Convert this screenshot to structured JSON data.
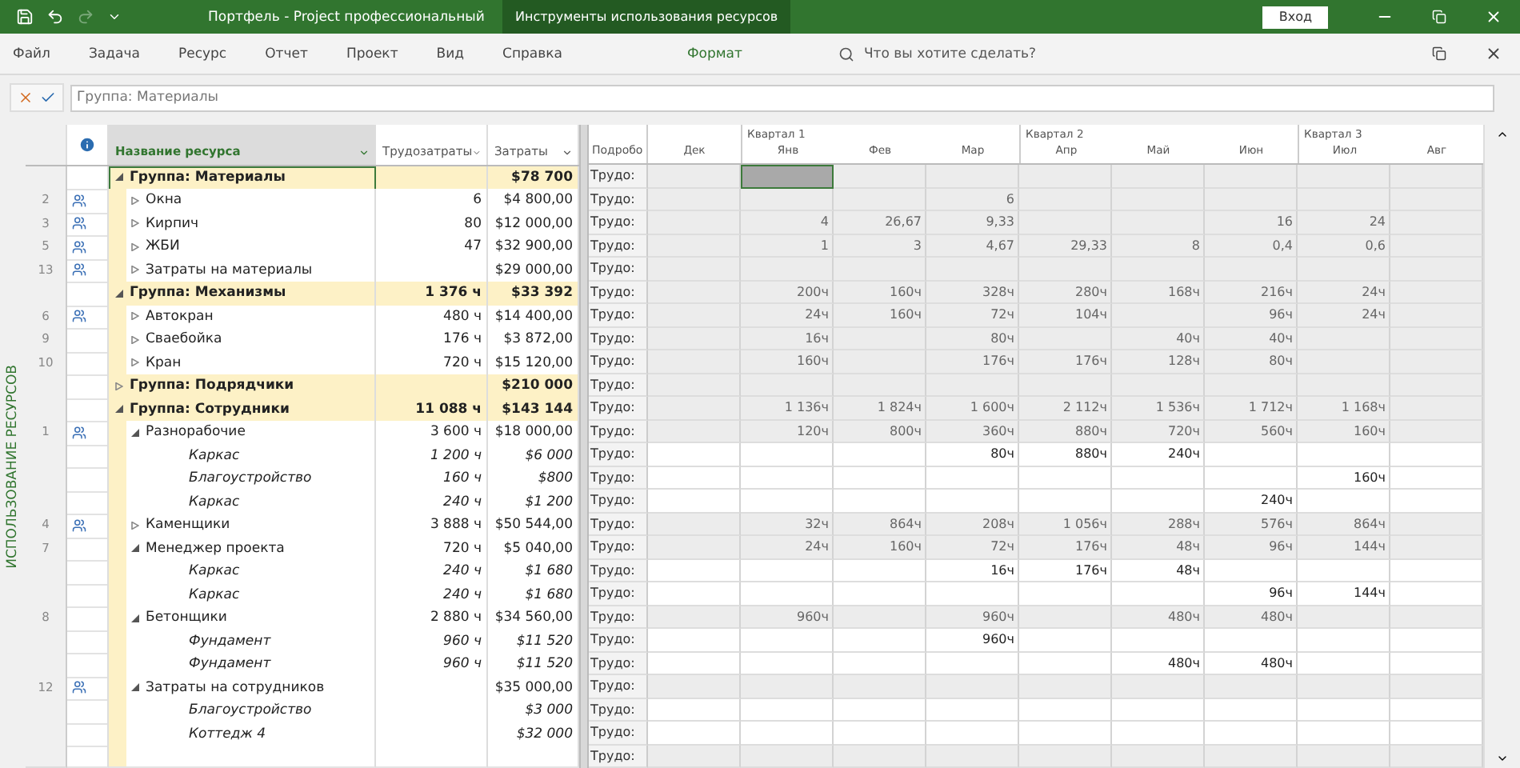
{
  "title_bar": {
    "title": "Портфель  -  Project профессиональный",
    "context_tab": "Инструменты использования ресурсов",
    "sign_in": "Вход"
  },
  "ribbon": {
    "tabs": [
      {
        "label": "Файл",
        "kind": "normal"
      },
      {
        "label": "Задача",
        "kind": "normal"
      },
      {
        "label": "Ресурс",
        "kind": "normal"
      },
      {
        "label": "Отчет",
        "kind": "normal"
      },
      {
        "label": "Проект",
        "kind": "normal"
      },
      {
        "label": "Вид",
        "kind": "normal"
      },
      {
        "label": "Справка",
        "kind": "normal"
      },
      {
        "label": "Формат",
        "kind": "context"
      }
    ],
    "search": {
      "placeholder": "Что вы хотите сделать?"
    }
  },
  "entry_bar": {
    "value": "Группа: Материалы"
  },
  "side_label": "ИСПОЛЬЗОВАНИЕ РЕСУРСОВ",
  "table": {
    "columns": [
      {
        "label": "Название ресурса",
        "selected": true
      },
      {
        "label": "Трудозатраты",
        "selected": false
      },
      {
        "label": "Затраты",
        "selected": false
      }
    ],
    "detail_header": "Подробо"
  },
  "timescale": {
    "months": [
      {
        "label": "Дек",
        "selected": false
      },
      {
        "label": "Янв",
        "quarter": "Квартал 1",
        "selected": true
      },
      {
        "label": "Фев",
        "selected": false
      },
      {
        "label": "Мар",
        "selected": false
      },
      {
        "label": "Апр",
        "quarter": "Квартал 2",
        "selected": false
      },
      {
        "label": "Май",
        "selected": false
      },
      {
        "label": "Июн",
        "selected": false
      },
      {
        "label": "Июл",
        "quarter": "Квартал 3",
        "selected": false
      },
      {
        "label": "Авг",
        "selected": false
      }
    ]
  },
  "rows": [
    {
      "kind": "group",
      "name": "Группа: Материалы",
      "expanded": true,
      "selected": true,
      "cost": "$78 700",
      "detail": "Трудо:",
      "children": [
        {
          "kind": "resource",
          "id": "2",
          "icon": true,
          "name": "Окна",
          "expanded": false,
          "selected": false,
          "work": "6",
          "cost": "$4 800,00",
          "detail": "Трудо:",
          "cells": [
            {
              "kind": "empty"
            },
            {
              "kind": "empty"
            },
            {
              "kind": "empty"
            },
            {
              "kind": "value",
              "value": "6"
            },
            {
              "kind": "empty"
            },
            {
              "kind": "empty"
            },
            {
              "kind": "empty"
            },
            {
              "kind": "empty"
            },
            {
              "kind": "empty"
            }
          ]
        },
        {
          "kind": "resource",
          "id": "3",
          "icon": true,
          "name": "Кирпич",
          "expanded": false,
          "selected": false,
          "work": "80",
          "cost": "$12 000,00",
          "detail": "Трудо:",
          "cells": [
            {
              "kind": "empty"
            },
            {
              "kind": "value",
              "value": "4"
            },
            {
              "kind": "value",
              "value": "26,67"
            },
            {
              "kind": "value",
              "value": "9,33"
            },
            {
              "kind": "empty"
            },
            {
              "kind": "empty"
            },
            {
              "kind": "value",
              "value": "16"
            },
            {
              "kind": "value",
              "value": "24"
            },
            {
              "kind": "empty"
            }
          ]
        },
        {
          "kind": "resource",
          "id": "5",
          "icon": true,
          "name": "ЖБИ",
          "expanded": false,
          "selected": false,
          "work": "47",
          "cost": "$32 900,00",
          "detail": "Трудо:",
          "cells": [
            {
              "kind": "empty"
            },
            {
              "kind": "value",
              "value": "1"
            },
            {
              "kind": "value",
              "value": "3"
            },
            {
              "kind": "value",
              "value": "4,67"
            },
            {
              "kind": "value",
              "value": "29,33"
            },
            {
              "kind": "value",
              "value": "8"
            },
            {
              "kind": "value",
              "value": "0,4"
            },
            {
              "kind": "value",
              "value": "0,6"
            },
            {
              "kind": "empty"
            }
          ]
        },
        {
          "kind": "resource",
          "id": "13",
          "icon": true,
          "name": "Затраты на материалы",
          "expanded": false,
          "selected": false,
          "cost": "$29 000,00",
          "detail": "Трудо:"
        }
      ]
    },
    {
      "kind": "group",
      "name": "Группа: Механизмы",
      "expanded": true,
      "selected": false,
      "work": "1 376 ч",
      "cost": "$33 392",
      "detail": "Трудо:",
      "cells": [
        {
          "kind": "empty"
        },
        {
          "kind": "value",
          "value": "200ч"
        },
        {
          "kind": "value",
          "value": "160ч"
        },
        {
          "kind": "value",
          "value": "328ч"
        },
        {
          "kind": "value",
          "value": "280ч"
        },
        {
          "kind": "value",
          "value": "168ч"
        },
        {
          "kind": "value",
          "value": "216ч"
        },
        {
          "kind": "value",
          "value": "24ч"
        },
        {
          "kind": "empty"
        }
      ],
      "children": [
        {
          "kind": "resource",
          "id": "6",
          "icon": true,
          "name": "Автокран",
          "expanded": false,
          "selected": false,
          "work": "480 ч",
          "cost": "$14 400,00",
          "detail": "Трудо:",
          "cells": [
            {
              "kind": "empty"
            },
            {
              "kind": "value",
              "value": "24ч"
            },
            {
              "kind": "value",
              "value": "160ч"
            },
            {
              "kind": "value",
              "value": "72ч"
            },
            {
              "kind": "value",
              "value": "104ч"
            },
            {
              "kind": "empty"
            },
            {
              "kind": "value",
              "value": "96ч"
            },
            {
              "kind": "value",
              "value": "24ч"
            },
            {
              "kind": "empty"
            }
          ]
        },
        {
          "kind": "resource",
          "id": "9",
          "icon": false,
          "name": "Сваебойка",
          "expanded": false,
          "selected": false,
          "work": "176 ч",
          "cost": "$3 872,00",
          "detail": "Трудо:",
          "cells": [
            {
              "kind": "empty"
            },
            {
              "kind": "value",
              "value": "16ч"
            },
            {
              "kind": "empty"
            },
            {
              "kind": "value",
              "value": "80ч"
            },
            {
              "kind": "empty"
            },
            {
              "kind": "value",
              "value": "40ч"
            },
            {
              "kind": "value",
              "value": "40ч"
            },
            {
              "kind": "empty"
            },
            {
              "kind": "empty"
            }
          ]
        },
        {
          "kind": "resource",
          "id": "10",
          "icon": false,
          "name": "Кран",
          "expanded": false,
          "selected": false,
          "work": "720 ч",
          "cost": "$15 120,00",
          "detail": "Трудо:",
          "cells": [
            {
              "kind": "empty"
            },
            {
              "kind": "value",
              "value": "160ч"
            },
            {
              "kind": "empty"
            },
            {
              "kind": "value",
              "value": "176ч"
            },
            {
              "kind": "value",
              "value": "176ч"
            },
            {
              "kind": "value",
              "value": "128ч"
            },
            {
              "kind": "value",
              "value": "80ч"
            },
            {
              "kind": "empty"
            },
            {
              "kind": "empty"
            }
          ]
        }
      ]
    },
    {
      "kind": "group",
      "name": "Группа: Подрядчики",
      "expanded": false,
      "selected": false,
      "cost": "$210 000",
      "detail": "Трудо:"
    },
    {
      "kind": "group",
      "name": "Группа: Сотрудники",
      "expanded": true,
      "selected": false,
      "work": "11 088 ч",
      "cost": "$143 144",
      "detail": "Трудо:",
      "cells": [
        {
          "kind": "empty"
        },
        {
          "kind": "value",
          "value": "1 136ч"
        },
        {
          "kind": "value",
          "value": "1 824ч"
        },
        {
          "kind": "value",
          "value": "1 600ч"
        },
        {
          "kind": "value",
          "value": "2 112ч"
        },
        {
          "kind": "value",
          "value": "1 536ч"
        },
        {
          "kind": "value",
          "value": "1 712ч"
        },
        {
          "kind": "value",
          "value": "1 168ч"
        },
        {
          "kind": "empty"
        }
      ],
      "children": [
        {
          "kind": "resource",
          "id": "1",
          "icon": true,
          "name": "Разнорабочие",
          "expanded": true,
          "selected": false,
          "work": "3 600 ч",
          "cost": "$18 000,00",
          "detail": "Трудо:",
          "cells": [
            {
              "kind": "empty"
            },
            {
              "kind": "value",
              "value": "120ч"
            },
            {
              "kind": "value",
              "value": "800ч"
            },
            {
              "kind": "value",
              "value": "360ч"
            },
            {
              "kind": "value",
              "value": "880ч"
            },
            {
              "kind": "value",
              "value": "720ч"
            },
            {
              "kind": "value",
              "value": "560ч"
            },
            {
              "kind": "value",
              "value": "160ч"
            },
            {
              "kind": "empty"
            }
          ],
          "children": [
            {
              "kind": "assignment",
              "name": "Каркас",
              "selected": false,
              "work": "1 200 ч",
              "cost": "$6 000",
              "detail": "Трудо:",
              "cells": [
                {
                  "kind": "empty"
                },
                {
                  "kind": "empty"
                },
                {
                  "kind": "empty"
                },
                {
                  "kind": "value",
                  "value": "80ч"
                },
                {
                  "kind": "value",
                  "value": "880ч"
                },
                {
                  "kind": "value",
                  "value": "240ч"
                },
                {
                  "kind": "empty"
                },
                {
                  "kind": "empty"
                },
                {
                  "kind": "empty"
                }
              ]
            },
            {
              "kind": "assignment",
              "name": "Благоустройство",
              "selected": false,
              "work": "160 ч",
              "cost": "$800",
              "detail": "Трудо:",
              "cells": [
                {
                  "kind": "empty"
                },
                {
                  "kind": "empty"
                },
                {
                  "kind": "empty"
                },
                {
                  "kind": "empty"
                },
                {
                  "kind": "empty"
                },
                {
                  "kind": "empty"
                },
                {
                  "kind": "empty"
                },
                {
                  "kind": "value",
                  "value": "160ч"
                },
                {
                  "kind": "empty"
                }
              ]
            },
            {
              "kind": "assignment",
              "name": "Каркас",
              "selected": false,
              "work": "240 ч",
              "cost": "$1 200",
              "detail": "Трудо:",
              "cells": [
                {
                  "kind": "empty"
                },
                {
                  "kind": "empty"
                },
                {
                  "kind": "empty"
                },
                {
                  "kind": "empty"
                },
                {
                  "kind": "empty"
                },
                {
                  "kind": "empty"
                },
                {
                  "kind": "value",
                  "value": "240ч"
                },
                {
                  "kind": "empty"
                },
                {
                  "kind": "empty"
                }
              ]
            }
          ]
        },
        {
          "kind": "resource",
          "id": "4",
          "icon": true,
          "name": "Каменщики",
          "expanded": false,
          "selected": false,
          "work": "3 888 ч",
          "cost": "$50 544,00",
          "detail": "Трудо:",
          "cells": [
            {
              "kind": "empty"
            },
            {
              "kind": "value",
              "value": "32ч"
            },
            {
              "kind": "value",
              "value": "864ч"
            },
            {
              "kind": "value",
              "value": "208ч"
            },
            {
              "kind": "value",
              "value": "1 056ч"
            },
            {
              "kind": "value",
              "value": "288ч"
            },
            {
              "kind": "value",
              "value": "576ч"
            },
            {
              "kind": "value",
              "value": "864ч"
            },
            {
              "kind": "empty"
            }
          ]
        },
        {
          "kind": "resource",
          "id": "7",
          "icon": false,
          "name": "Менеджер проекта",
          "expanded": true,
          "selected": false,
          "work": "720 ч",
          "cost": "$5 040,00",
          "detail": "Трудо:",
          "cells": [
            {
              "kind": "empty"
            },
            {
              "kind": "value",
              "value": "24ч"
            },
            {
              "kind": "value",
              "value": "160ч"
            },
            {
              "kind": "value",
              "value": "72ч"
            },
            {
              "kind": "value",
              "value": "176ч"
            },
            {
              "kind": "value",
              "value": "48ч"
            },
            {
              "kind": "value",
              "value": "96ч"
            },
            {
              "kind": "value",
              "value": "144ч"
            },
            {
              "kind": "empty"
            }
          ],
          "children": [
            {
              "kind": "assignment",
              "name": "Каркас",
              "selected": false,
              "work": "240 ч",
              "cost": "$1 680",
              "detail": "Трудо:",
              "cells": [
                {
                  "kind": "empty"
                },
                {
                  "kind": "empty"
                },
                {
                  "kind": "empty"
                },
                {
                  "kind": "value",
                  "value": "16ч"
                },
                {
                  "kind": "value",
                  "value": "176ч"
                },
                {
                  "kind": "value",
                  "value": "48ч"
                },
                {
                  "kind": "empty"
                },
                {
                  "kind": "empty"
                },
                {
                  "kind": "empty"
                }
              ]
            },
            {
              "kind": "assignment",
              "name": "Каркас",
              "selected": false,
              "work": "240 ч",
              "cost": "$1 680",
              "detail": "Трудо:",
              "cells": [
                {
                  "kind": "empty"
                },
                {
                  "kind": "empty"
                },
                {
                  "kind": "empty"
                },
                {
                  "kind": "empty"
                },
                {
                  "kind": "empty"
                },
                {
                  "kind": "empty"
                },
                {
                  "kind": "value",
                  "value": "96ч"
                },
                {
                  "kind": "value",
                  "value": "144ч"
                },
                {
                  "kind": "empty"
                }
              ]
            }
          ]
        },
        {
          "kind": "resource",
          "id": "8",
          "icon": false,
          "name": "Бетонщики",
          "expanded": true,
          "selected": false,
          "work": "2 880 ч",
          "cost": "$34 560,00",
          "detail": "Трудо:",
          "cells": [
            {
              "kind": "empty"
            },
            {
              "kind": "value",
              "value": "960ч"
            },
            {
              "kind": "empty"
            },
            {
              "kind": "value",
              "value": "960ч"
            },
            {
              "kind": "empty"
            },
            {
              "kind": "value",
              "value": "480ч"
            },
            {
              "kind": "value",
              "value": "480ч"
            },
            {
              "kind": "empty"
            },
            {
              "kind": "empty"
            }
          ],
          "children": [
            {
              "kind": "assignment",
              "name": "Фундамент",
              "selected": false,
              "work": "960 ч",
              "cost": "$11 520",
              "detail": "Трудо:",
              "cells": [
                {
                  "kind": "empty"
                },
                {
                  "kind": "empty"
                },
                {
                  "kind": "empty"
                },
                {
                  "kind": "value",
                  "value": "960ч"
                },
                {
                  "kind": "empty"
                },
                {
                  "kind": "empty"
                },
                {
                  "kind": "empty"
                },
                {
                  "kind": "empty"
                },
                {
                  "kind": "empty"
                }
              ]
            },
            {
              "kind": "assignment",
              "name": "Фундамент",
              "selected": false,
              "work": "960 ч",
              "cost": "$11 520",
              "detail": "Трудо:",
              "cells": [
                {
                  "kind": "empty"
                },
                {
                  "kind": "empty"
                },
                {
                  "kind": "empty"
                },
                {
                  "kind": "empty"
                },
                {
                  "kind": "empty"
                },
                {
                  "kind": "value",
                  "value": "480ч"
                },
                {
                  "kind": "value",
                  "value": "480ч"
                },
                {
                  "kind": "empty"
                },
                {
                  "kind": "empty"
                }
              ]
            }
          ]
        },
        {
          "kind": "resource",
          "id": "12",
          "icon": true,
          "name": "Затраты на сотрудников",
          "expanded": true,
          "selected": false,
          "cost": "$35 000,00",
          "detail": "Трудо:",
          "children": [
            {
              "kind": "assignment",
              "name": "Благоустройство",
              "selected": false,
              "cost": "$3 000",
              "detail": "Трудо:"
            },
            {
              "kind": "assignment",
              "name": "Коттедж 4",
              "selected": false,
              "cost": "$32 000",
              "detail": "Трудо:"
            }
          ]
        }
      ]
    },
    {
      "kind": "blank",
      "selected": false,
      "detail": "Трудо:"
    }
  ]
}
